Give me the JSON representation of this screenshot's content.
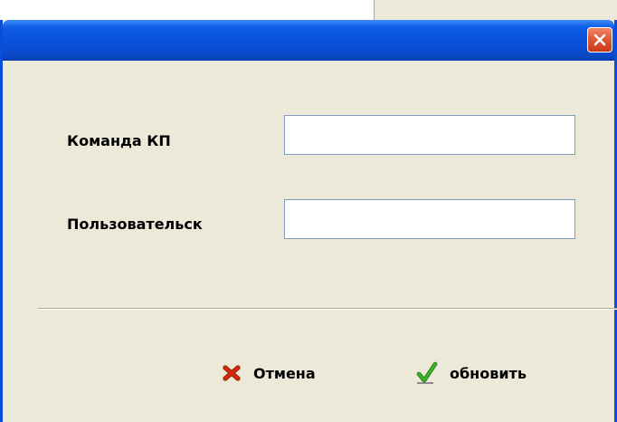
{
  "dialog": {
    "title": "",
    "fields": {
      "command": {
        "label": "Команда КП",
        "value": ""
      },
      "user": {
        "label": "Пользовательск",
        "value": ""
      }
    },
    "buttons": {
      "cancel_label": "Отмена",
      "update_label": "обновить"
    },
    "icons": {
      "close": "close-icon",
      "cancel": "red-x-icon",
      "update": "green-checkmark-icon"
    }
  },
  "colors": {
    "titlebar": "#0a51d9",
    "dialog_bg": "#ece9d8",
    "close_button": "#e05a36",
    "cancel_icon": "#d42a0c",
    "update_icon": "#2e9a1c"
  }
}
